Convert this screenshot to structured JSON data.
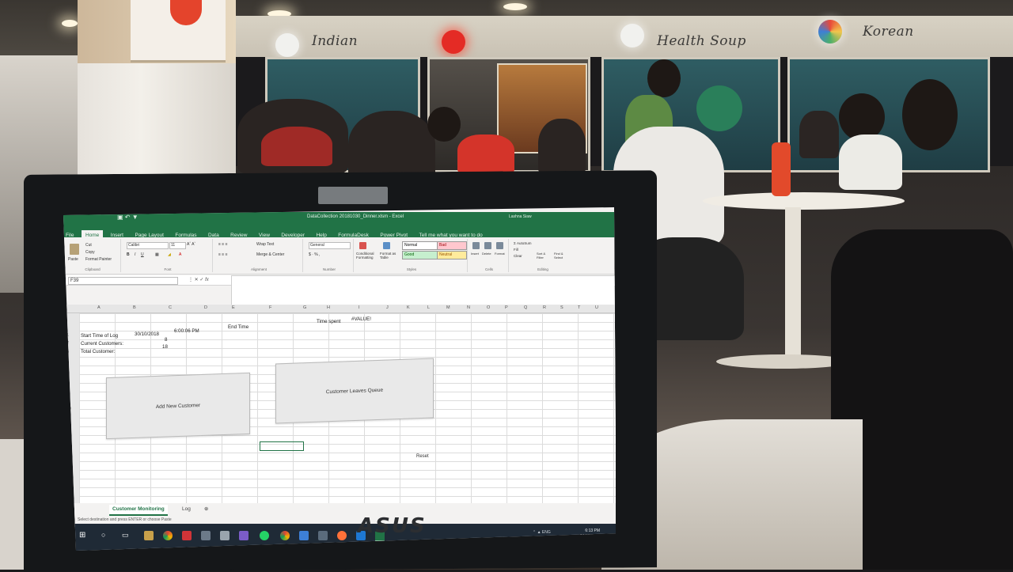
{
  "background_signs": {
    "stall_1": "Indian",
    "stall_2": "Health Soup",
    "stall_3": "Korean"
  },
  "laptop": {
    "brand": "ASUS"
  },
  "excel": {
    "title": "DataCollection 20181030_Dinner.xlsm - Excel",
    "user": "Lashna Siaw",
    "ribbon_tabs": [
      "File",
      "Home",
      "Insert",
      "Page Layout",
      "Formulas",
      "Data",
      "Review",
      "View",
      "Developer",
      "Help",
      "FormulaDesk",
      "Power Pivot"
    ],
    "active_tab": "Home",
    "tell_me": "Tell me what you want to do",
    "ribbon": {
      "paste": "Paste",
      "cut": "Cut",
      "copy": "Copy",
      "format_painter": "Format Painter",
      "clipboard_group": "Clipboard",
      "font_name": "Calibri",
      "font_size": "11",
      "font_group": "Font",
      "wrap_text": "Wrap Text",
      "merge_center": "Merge & Center",
      "alignment_group": "Alignment",
      "number_format": "General",
      "number_group": "Number",
      "conditional_formatting": "Conditional Formatting",
      "format_as_table": "Format as Table",
      "styles": [
        "Normal",
        "Bad",
        "Good",
        "Neutral"
      ],
      "styles_group": "Styles",
      "insert": "Insert",
      "delete": "Delete",
      "format": "Format",
      "cells_group": "Cells",
      "autosum": "AutoSum",
      "fill": "Fill",
      "clear": "Clear",
      "sort_filter": "Sort & Filter",
      "find_select": "Find & Select",
      "editing_group": "Editing"
    },
    "name_box": "F39",
    "columns": [
      "A",
      "B",
      "C",
      "D",
      "E",
      "F",
      "G",
      "H",
      "I",
      "J",
      "K",
      "L",
      "M",
      "N",
      "O",
      "P",
      "Q",
      "R",
      "S",
      "T",
      "U"
    ],
    "rows": [
      "1",
      "2",
      "3",
      "4",
      "5",
      "6",
      "7",
      "8",
      "9",
      "10",
      "11",
      "12",
      "13",
      "14",
      "15",
      "16",
      "17",
      "18",
      "19",
      "20",
      "21",
      "22",
      "23",
      "24"
    ],
    "cells": {
      "a1": "Start Time of Log",
      "b1": "30/10/2018",
      "c1": "6:00:06 PM",
      "e1": "End Time",
      "h1": "Time spent",
      "i1": "#VALUE!",
      "a2": "Current Customers:",
      "b2": "8",
      "a3": "Total Customer:",
      "b3": "18"
    },
    "buttons": {
      "add_customer": "Add New Customer",
      "customer_leaves": "Customer Leaves Queue",
      "reset": "Reset"
    },
    "sheet_tabs": [
      "Customer Monitoring",
      "Log"
    ],
    "status_text": "Select destination and press ENTER or choose Paste",
    "clock_time": "6:13 PM",
    "clock_date": "30/10/2018",
    "tray_lang": "ENG"
  },
  "colors": {
    "excel_green": "#217346",
    "taskbar": "#1f2a36",
    "style_bad": "#ffc7ce",
    "style_good": "#c6efce",
    "style_neutral": "#ffeb9c"
  }
}
